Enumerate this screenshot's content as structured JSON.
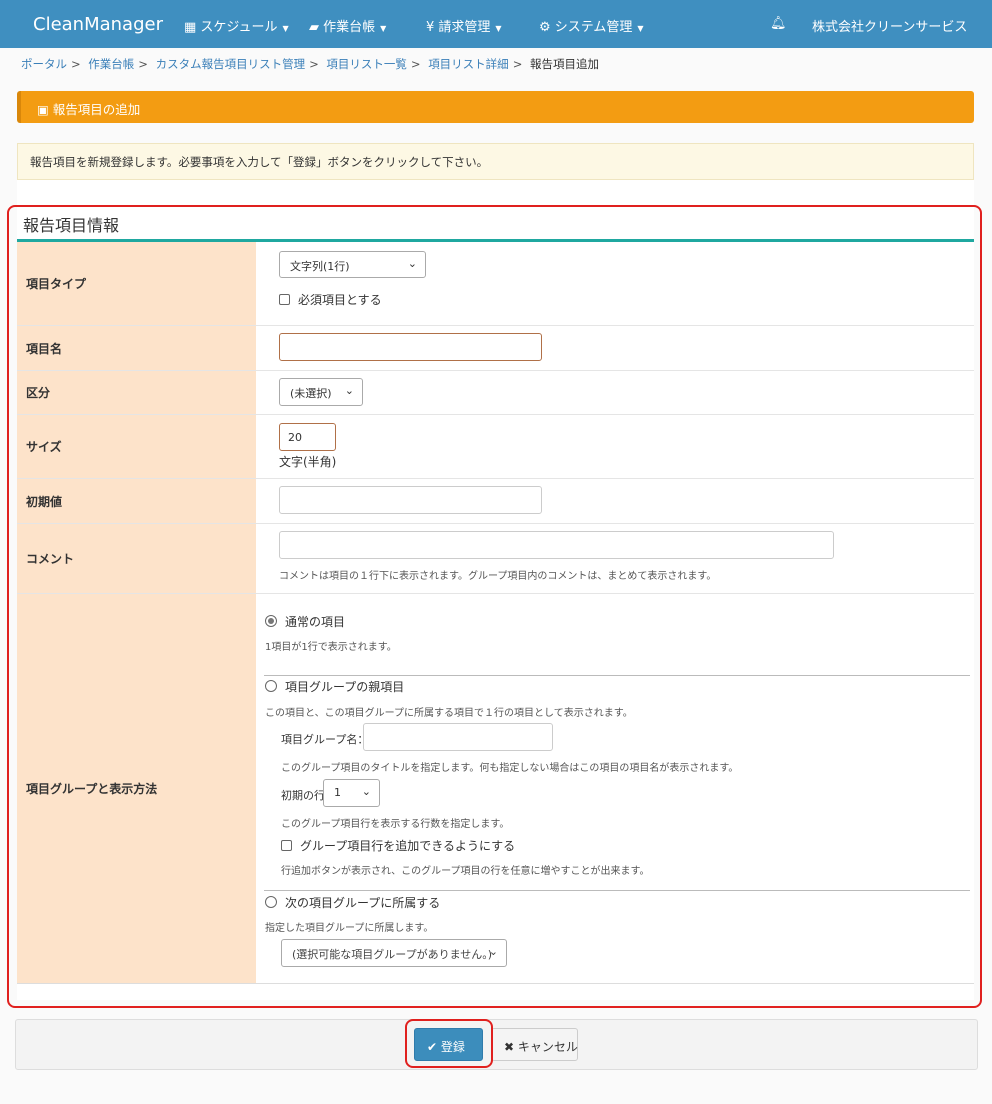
{
  "nav": {
    "brand": "CleanManager",
    "menus": [
      {
        "icon": "calendar-icon",
        "label": "スケジュール"
      },
      {
        "icon": "book-icon",
        "label": "作業台帳"
      },
      {
        "icon": "yen-icon",
        "label": "請求管理"
      },
      {
        "icon": "cogs-icon",
        "label": "システム管理"
      }
    ],
    "bell_icon": "bell-icon",
    "company": "株式会社クリーンサービス"
  },
  "breadcrumb": [
    "ポータル",
    "作業台帳",
    "カスタム報告項目リスト管理",
    "項目リスト一覧",
    "項目リスト詳細"
  ],
  "breadcrumb_current": "報告項目追加",
  "panel_title": "報告項目の追加",
  "info_message": "報告項目を新規登録します。必要事項を入力して「登録」ボタンをクリックして下さい。",
  "section_title": "報告項目情報",
  "form": {
    "item_type": {
      "label": "項目タイプ",
      "value": "文字列(1行)",
      "required_label": "必須項目とする",
      "required": false
    },
    "item_name": {
      "label": "項目名",
      "value": ""
    },
    "category": {
      "label": "区分",
      "value": "(未選択)"
    },
    "size": {
      "label": "サイズ",
      "value": "20",
      "unit": "文字(半角)"
    },
    "initial": {
      "label": "初期値",
      "value": ""
    },
    "comment": {
      "label": "コメント",
      "value": "",
      "help": "コメントは項目の１行下に表示されます。グループ項目内のコメントは、まとめて表示されます。"
    },
    "group": {
      "label": "項目グループと表示方法",
      "normal": {
        "label": "通常の項目",
        "help": "1項目が1行で表示されます。",
        "checked": true
      },
      "parent": {
        "label": "項目グループの親項目",
        "help": "この項目と、この項目グループに所属する項目で１行の項目として表示されます。",
        "name_label": "項目グループ名：",
        "name_value": "",
        "name_help": "このグループ項目のタイトルを指定します。何も指定しない場合はこの項目の項目名が表示されます。",
        "rows_label": "初期の行数：",
        "rows_value": "1",
        "rows_help": "このグループ項目行を表示する行数を指定します。",
        "addable_label": "グループ項目行を追加できるようにする",
        "addable_help": "行追加ボタンが表示され、このグループ項目の行を任意に増やすことが出来ます。",
        "checked": false
      },
      "member": {
        "label": "次の項目グループに所属する",
        "help": "指定した項目グループに所属します。",
        "select_value": "(選択可能な項目グループがありません。)",
        "checked": false
      }
    }
  },
  "buttons": {
    "register": "登録",
    "cancel": "キャンセル"
  }
}
